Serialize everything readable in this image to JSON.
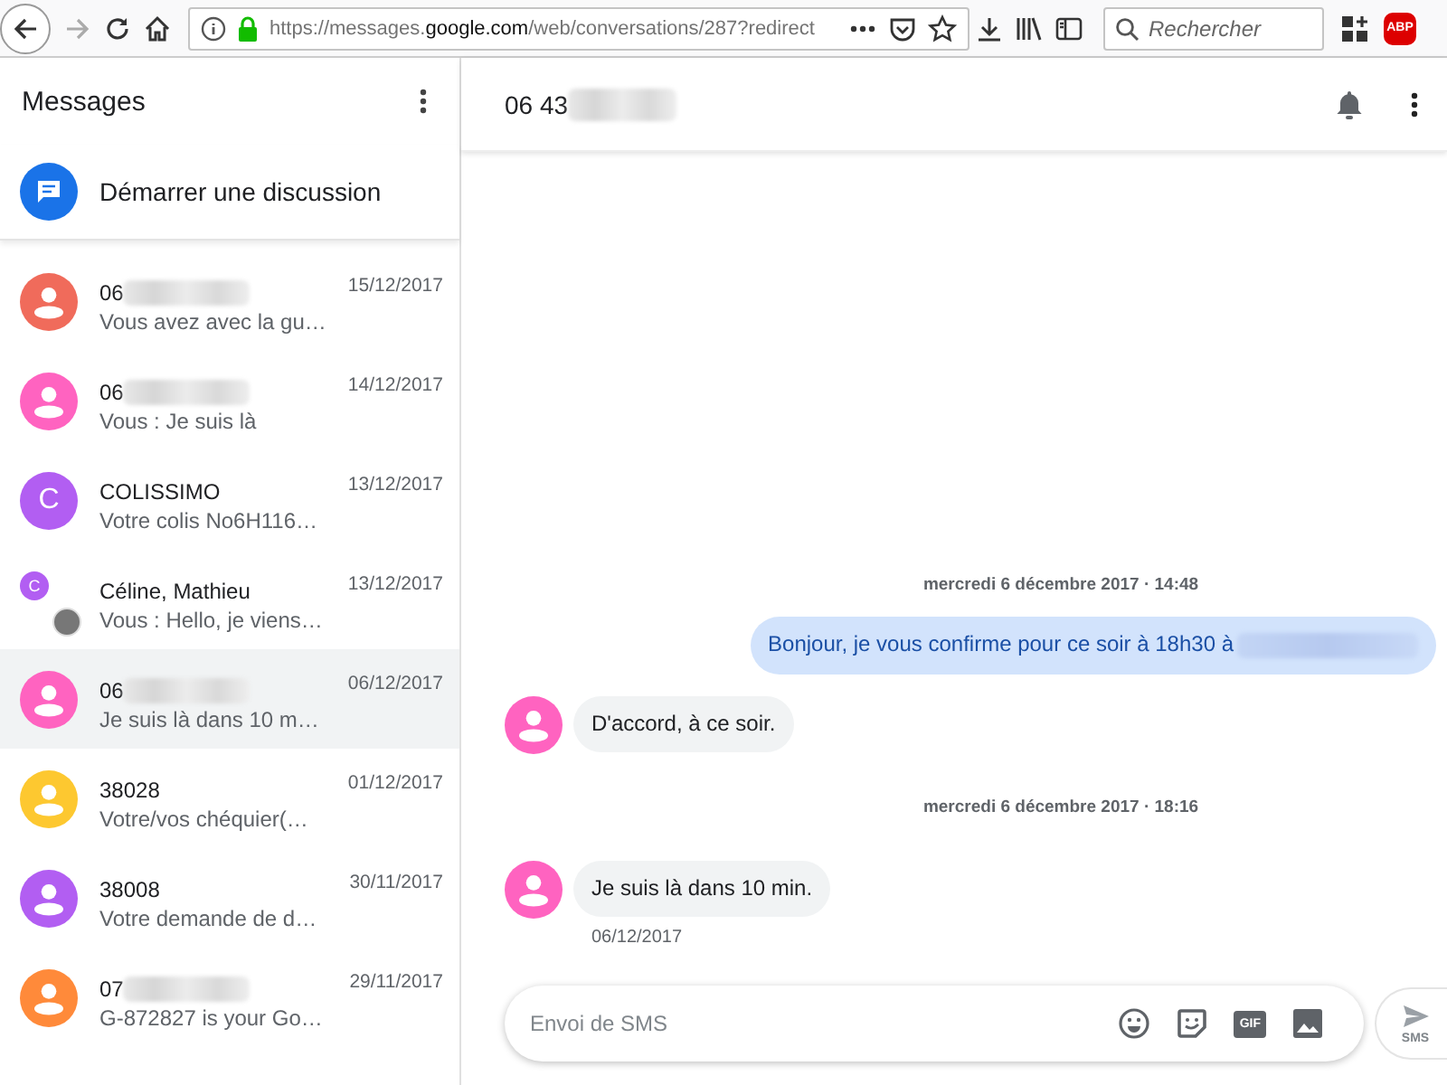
{
  "browser": {
    "url": "https://messages.**google.com**/web/conversations/287?redirect",
    "search": {
      "placeholder": "Rechercher"
    },
    "extension_badge": "ABP"
  },
  "sidebar": {
    "title": "Messages",
    "start_button": "Démarrer une discussion",
    "conversations": [
      {
        "name": "06",
        "redacted": true,
        "snippet": "Vous avez avec la gu…",
        "date": "15/12/2017",
        "kind": "person",
        "color": "#f06b5b",
        "selected": false
      },
      {
        "name": "06",
        "redacted": true,
        "snippet": "Vous : Je suis là",
        "date": "14/12/2017",
        "kind": "person",
        "color": "#ff63c0",
        "selected": false
      },
      {
        "name": "COLISSIMO",
        "redacted": false,
        "snippet": "Votre colis No6H116…",
        "date": "13/12/2017",
        "kind": "letter",
        "letter": "C",
        "color": "#b25ef2",
        "selected": false
      },
      {
        "name": "Céline, Mathieu",
        "redacted": false,
        "snippet": "Vous : Hello, je viens…",
        "date": "13/12/2017",
        "kind": "group",
        "letter": "C",
        "color": "#b25ef2",
        "selected": false
      },
      {
        "name": "06",
        "redacted": true,
        "snippet": "Je suis là dans 10 m…",
        "date": "06/12/2017",
        "kind": "person",
        "color": "#ff63c0",
        "selected": true
      },
      {
        "name": "38028",
        "redacted": false,
        "snippet": "Votre/vos chéquier(…",
        "date": "01/12/2017",
        "kind": "person",
        "color": "#fdc830",
        "selected": false
      },
      {
        "name": "38008",
        "redacted": false,
        "snippet": "Votre demande de d…",
        "date": "30/11/2017",
        "kind": "person",
        "color": "#b25ef2",
        "selected": false
      },
      {
        "name": "07",
        "redacted": true,
        "snippet": "G-872827 is your Go…",
        "date": "29/11/2017",
        "kind": "person",
        "color": "#ff8a3a",
        "selected": false
      }
    ]
  },
  "conversation": {
    "title": "06 43",
    "redacted": true,
    "messages": [
      {
        "kind": "timestamp",
        "text": "mercredi 6 décembre 2017 · 14:48"
      },
      {
        "kind": "outgoing",
        "text": "Bonjour, je vous confirme pour ce soir à 18h30 à",
        "redacted": true
      },
      {
        "kind": "incoming",
        "text": "D'accord, à ce soir.",
        "color": "#ff63c0"
      },
      {
        "kind": "timestamp",
        "text": "mercredi 6 décembre 2017 · 18:16"
      },
      {
        "kind": "incoming",
        "text": "Je suis là dans 10 min.",
        "color": "#ff63c0",
        "date": "06/12/2017"
      }
    ],
    "compose": {
      "placeholder": "Envoi de SMS",
      "gif_label": "GIF",
      "send_label": "SMS"
    }
  }
}
